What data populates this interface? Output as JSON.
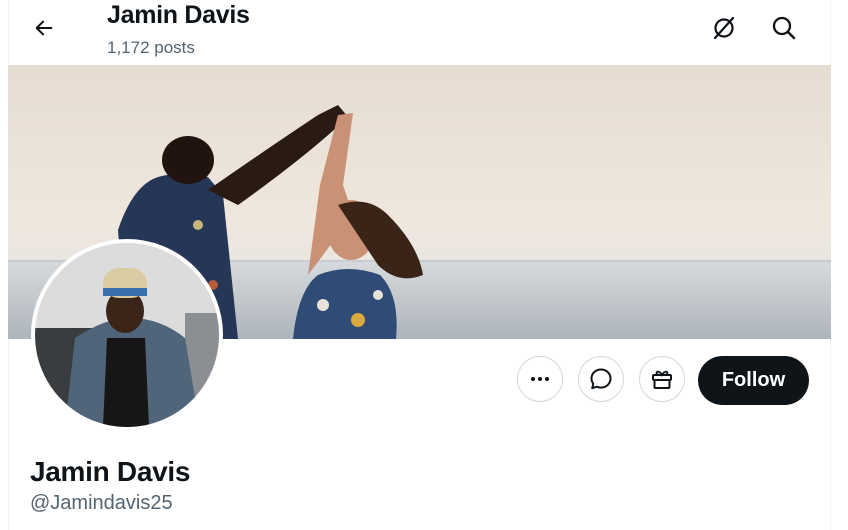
{
  "header": {
    "name": "Jamin Davis",
    "posts_count": "1,172 posts"
  },
  "profile": {
    "display_name": "Jamin Davis",
    "handle": "@Jamindavis25"
  },
  "actions": {
    "follow_label": "Follow"
  },
  "icons": {
    "back": "arrow-left-icon",
    "grok": "grok-icon",
    "search": "search-icon",
    "more": "more-horizontal-icon",
    "message": "message-icon",
    "gift": "gift-icon"
  },
  "colors": {
    "follow_bg": "#0f1419",
    "muted_text": "#536471",
    "border": "#cfd9de"
  }
}
